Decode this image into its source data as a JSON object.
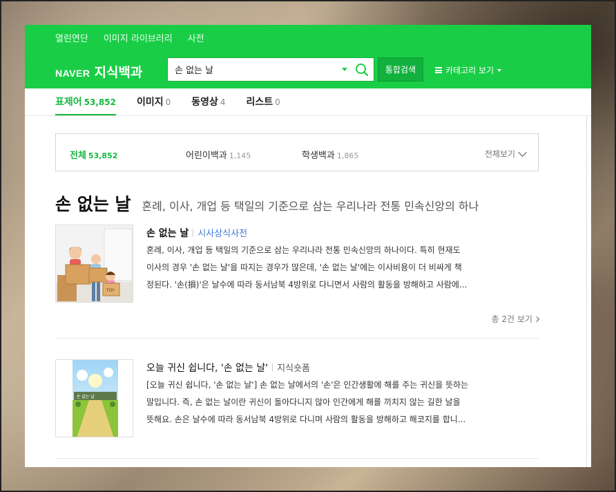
{
  "header": {
    "top_links": [
      "열린연단",
      "이미지 라이브러리",
      "사전"
    ],
    "logo_brand": "NAVER",
    "logo_service": "지식백과",
    "search_value": "손 없는 날",
    "integrated_search_label": "통합검색",
    "category_label": "카테고리 보기",
    "brand_color": "#19ce46"
  },
  "tabs": [
    {
      "label": "표제어",
      "count": "53,852",
      "active": true
    },
    {
      "label": "이미지",
      "count": "0"
    },
    {
      "label": "동영상",
      "count": "4"
    },
    {
      "label": "리스트",
      "count": "0"
    }
  ],
  "filters": [
    {
      "label": "전체",
      "count": "53,852",
      "active": true
    },
    {
      "label": "어린이백과",
      "count": "1,145"
    },
    {
      "label": "학생백과",
      "count": "1,865"
    }
  ],
  "filter_view_all": "전체보기",
  "term": {
    "title": "손 없는 날",
    "description": "혼례, 이사, 개업 등 택일의 기준으로 삼는 우리나라 전통 민속신앙의 하나"
  },
  "results": [
    {
      "title": "손 없는 날",
      "source": "시사상식사전",
      "lines": [
        "혼례, 이사, 개업 등 택일의 기준으로 삼는 우리나라 전통 민속신앙의 하나이다. 특히 현재도",
        "이사의 경우 '손 없는 날'을 따지는 경우가 많은데, '손 없는 날'에는 이사비용이 더 비싸게 책",
        "정된다. '손(損)'은 날수에 따라 동서남북 4방위로 다니면서 사람의 활동을 방해하고 사람에..."
      ],
      "more": "총 2건 보기",
      "thumb_icon": "moving-family-illustration"
    },
    {
      "title": "오늘 귀신 쉽니다, '손 없는 날'",
      "source": "지식숏폼",
      "lines": [
        "[오늘 귀신 쉽니다, '손 없는 날'] 손 없는 날에서의 '손'은 인간생활에 해를 주는 귀신을 뜻하는",
        "말입니다. 즉, 손 없는 날이란 귀신이 돌아다니지 않아 인간에게 해를 끼치지 않는 길한 날을",
        "뜻해요. 손은 날수에 따라 동서남북 4방위로 다니며 사람의 활동을 방해하고 해코지를 합니..."
      ],
      "thumb_icon": "sunny-road-illustration"
    }
  ]
}
